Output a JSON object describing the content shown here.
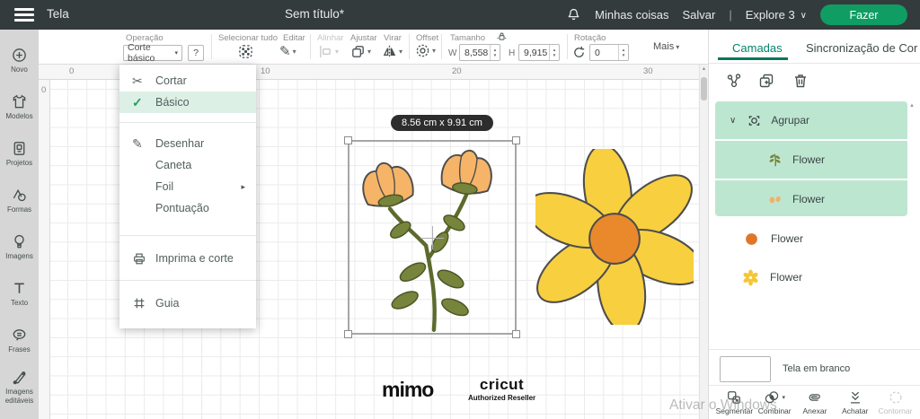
{
  "colors": {
    "topbar_bg": "#343b3d",
    "accent_green": "#0f9d63",
    "tab_teal": "#00856a",
    "mint_highlight": "#bde6d1",
    "menu_highlight": "#ddf0e6",
    "petal_orange": "#f6b468",
    "leaf_olive": "#76843c",
    "daisy_yellow": "#f8cf3f",
    "daisy_center": "#e9892b"
  },
  "icons": {
    "dropdown_arrow": "▾",
    "submenu_arrow": "▸",
    "check": "✓",
    "scissors": "✂",
    "pencil": "✎",
    "chevron_down": "∨",
    "up_arrow": "▲",
    "down_arrow": "▼",
    "help": "?"
  },
  "topbar": {
    "menu_label": "Tela",
    "title": "Sem título*",
    "minhas_coisas": "Minhas coisas",
    "salvar": "Salvar",
    "separator": "|",
    "machine": "Explore 3",
    "fazer": "Fazer"
  },
  "sidebar": {
    "items": [
      {
        "label": "Novo"
      },
      {
        "label": "Modelos"
      },
      {
        "label": "Projetos"
      },
      {
        "label": "Formas"
      },
      {
        "label": "Imagens"
      },
      {
        "label": "Texto"
      },
      {
        "label": "Frases"
      },
      {
        "label": "Imagens editáveis"
      }
    ]
  },
  "toolbar": {
    "operacao_label": "Operação",
    "operacao_value": "Corte básico",
    "selecionar_tudo": "Selecionar tudo",
    "editar": "Editar",
    "alinhar": "Alinhar",
    "ajustar": "Ajustar",
    "virar": "Virar",
    "offset": "Offset",
    "tamanho": "Tamanho",
    "w_label": "W",
    "w_value": "8,558",
    "h_label": "H",
    "h_value": "9,915",
    "rotacao_label": "Rotação",
    "rotacao_value": "0",
    "mais": "Mais"
  },
  "menu": {
    "items": [
      {
        "label": "Cortar"
      },
      {
        "label": "Básico"
      },
      {
        "label": "Desenhar"
      },
      {
        "label": "Caneta"
      },
      {
        "label": "Foil"
      },
      {
        "label": "Pontuação"
      },
      {
        "label": "Imprima e corte"
      },
      {
        "label": "Guia"
      }
    ]
  },
  "canvas": {
    "ruler_h": [
      "0",
      "10",
      "20",
      "30"
    ],
    "ruler_v": "0",
    "size_tooltip": "8.56 cm x 9.91 cm",
    "logo_mimo": "mimo",
    "logo_cricut": "cricut",
    "logo_cricut_sub": "Authorized Reseller",
    "windows_watermark": "Ativar o Windows"
  },
  "panel": {
    "tabs": [
      {
        "label": "Camadas"
      },
      {
        "label": "Sincronização de Cor"
      }
    ],
    "group_label": "Agrupar",
    "layers": [
      {
        "name": "Flower"
      },
      {
        "name": "Flower"
      },
      {
        "name": "Flower"
      },
      {
        "name": "Flower"
      }
    ],
    "mat_label": "Tela em branco",
    "actions": [
      {
        "label": "Segmentar"
      },
      {
        "label": "Combinar"
      },
      {
        "label": "Anexar"
      },
      {
        "label": "Achatar"
      },
      {
        "label": "Contornar"
      }
    ]
  }
}
